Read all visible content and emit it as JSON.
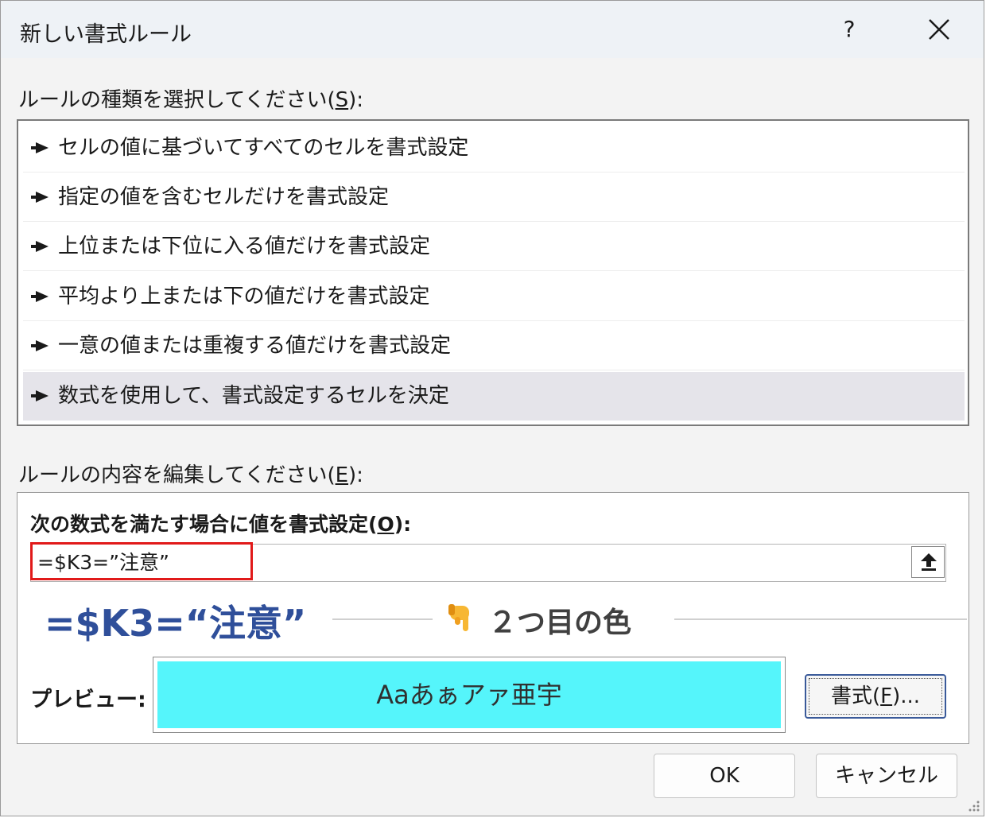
{
  "dialog": {
    "title": "新しい書式ルール",
    "help_label": "?",
    "close_icon": "close-icon"
  },
  "rule_type": {
    "label_prefix": "ルールの種類を選択してください(",
    "label_key": "S",
    "label_suffix": "):",
    "items": [
      {
        "label": "セルの値に基づいてすべてのセルを書式設定",
        "selected": false
      },
      {
        "label": "指定の値を含むセルだけを書式設定",
        "selected": false
      },
      {
        "label": "上位または下位に入る値だけを書式設定",
        "selected": false
      },
      {
        "label": "平均より上または下の値だけを書式設定",
        "selected": false
      },
      {
        "label": "一意の値または重複する値だけを書式設定",
        "selected": false
      },
      {
        "label": "数式を使用して、書式設定するセルを決定",
        "selected": true
      }
    ]
  },
  "rule_edit": {
    "label_prefix": "ルールの内容を編集してください(",
    "label_key": "E",
    "label_suffix": "):",
    "formula_label_prefix": "次の数式を満たす場合に値を書式設定(",
    "formula_label_key": "O",
    "formula_label_suffix": "):",
    "formula_value": "=$K3=”注意”",
    "collapse_icon": "upload-arrow-icon"
  },
  "annotation": {
    "formula": "=$K3=“注意”",
    "hand_icon": "pointing-hand-icon",
    "text": "２つ目の色",
    "highlight_color": "#e11a1a",
    "formula_color": "#2f4f9a"
  },
  "preview": {
    "label": "プレビュー:",
    "sample_text": "Aaあぁアァ亜宇",
    "fill_color": "#55f5fb"
  },
  "buttons": {
    "format_prefix": "書式(",
    "format_key": "F",
    "format_suffix": ")...",
    "ok": "OK",
    "cancel": "キャンセル"
  }
}
